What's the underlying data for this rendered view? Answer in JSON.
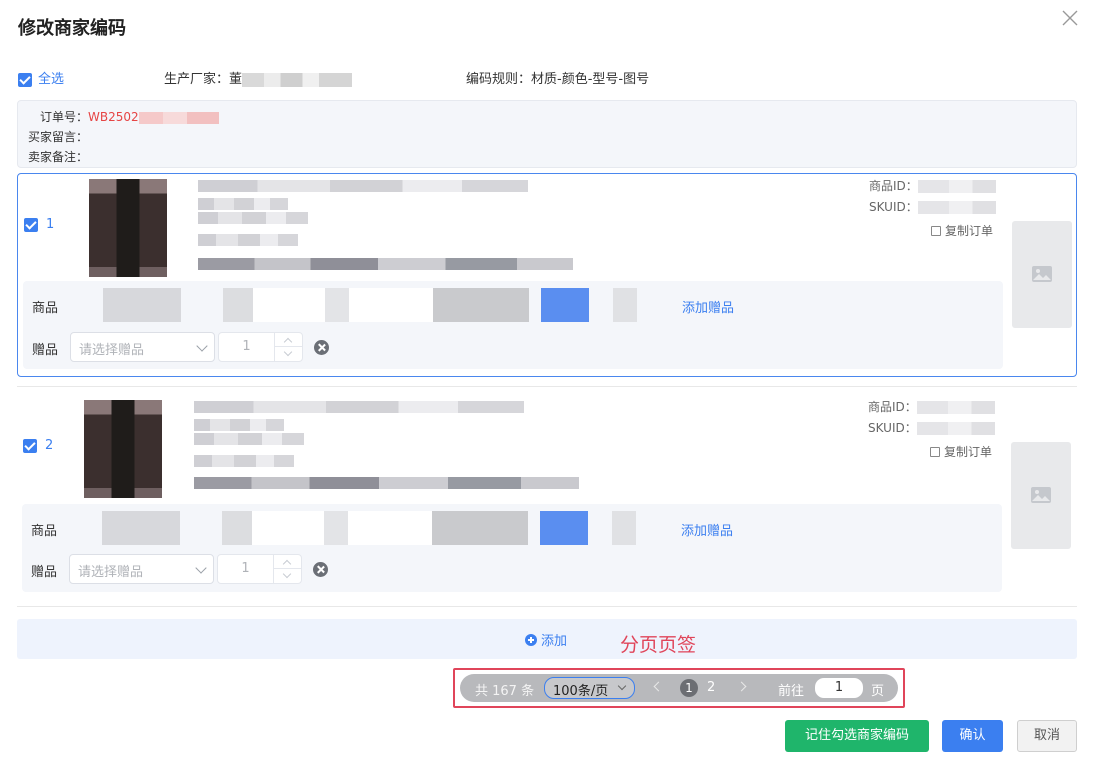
{
  "dialog": {
    "title": "修改商家编码"
  },
  "top": {
    "select_all": "全选",
    "maker_label": "生产厂家：",
    "maker_value": "董",
    "rule_label": "编码规则：",
    "rule_value": "材质-颜色-型号-图号"
  },
  "order": {
    "no_label": "订单号：",
    "no_value": "WB2502",
    "buyer_msg_label": "买家留言：",
    "seller_note_label": "卖家备注："
  },
  "items": [
    {
      "index": "1",
      "goods_id_label": "商品ID：",
      "sku_label": "SKUID：",
      "copy": "复制订单",
      "goods_label": "商品",
      "add_gift": "添加赠品",
      "gift_label": "赠品",
      "gift_placeholder": "请选择赠品",
      "qty": "1"
    },
    {
      "index": "2",
      "goods_id_label": "商品ID：",
      "sku_label": "SKUID：",
      "copy": "复制订单",
      "goods_label": "商品",
      "add_gift": "添加赠品",
      "gift_label": "赠品",
      "gift_placeholder": "请选择赠品",
      "qty": "1"
    }
  ],
  "add": {
    "label": "添加"
  },
  "annotation": "分页页签",
  "pagination": {
    "total": "共 167 条",
    "page_size": "100条/页",
    "pages": [
      "1",
      "2"
    ],
    "current": 1,
    "goto_label": "前往",
    "goto_value": "1",
    "page_suffix": "页"
  },
  "buttons": {
    "remember": "记住勾选商家编码",
    "confirm": "确认",
    "cancel": "取消"
  },
  "colors": {
    "primary": "#3b7ff0",
    "green": "#1fb56b",
    "annotation": "#e0455a"
  }
}
